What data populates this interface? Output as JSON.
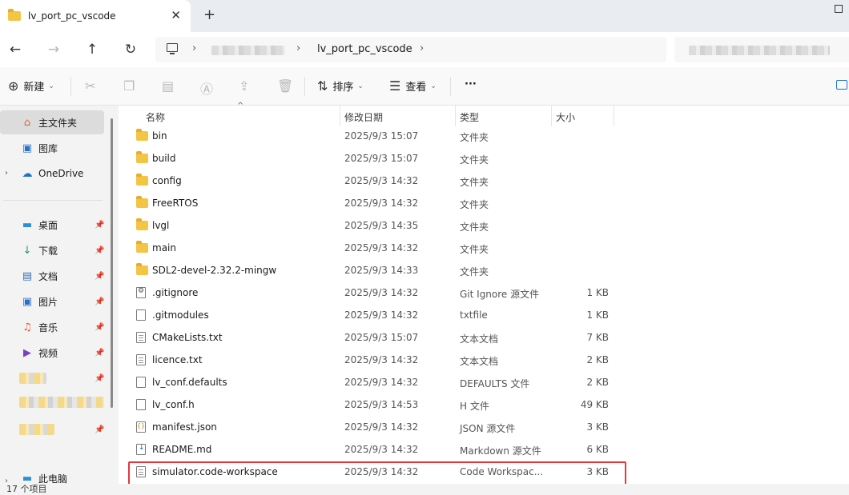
{
  "window": {
    "tab_title": "lv_port_pc_vscode",
    "tab_close": "✕",
    "new_tab": "+"
  },
  "address": {
    "current_folder": "lv_port_pc_vscode",
    "separator": "›"
  },
  "toolbar": {
    "new_label": "新建",
    "sort_label": "排序",
    "view_label": "查看",
    "more_label": "···"
  },
  "sidebar": {
    "home": "主文件夹",
    "gallery": "图库",
    "onedrive": "OneDrive",
    "quick_access": [
      {
        "label": "桌面",
        "icon": "desktop-icon"
      },
      {
        "label": "下载",
        "icon": "download-icon"
      },
      {
        "label": "文档",
        "icon": "documents-icon"
      },
      {
        "label": "图片",
        "icon": "pictures-icon"
      },
      {
        "label": "音乐",
        "icon": "music-icon"
      },
      {
        "label": "视频",
        "icon": "videos-icon"
      }
    ],
    "this_pc": "此电脑"
  },
  "columns": {
    "name": "名称",
    "date": "修改日期",
    "type": "类型",
    "size": "大小"
  },
  "files": [
    {
      "name": "bin",
      "date": "2025/9/3 15:07",
      "type": "文件夹",
      "size": "",
      "kind": "folder"
    },
    {
      "name": "build",
      "date": "2025/9/3 15:07",
      "type": "文件夹",
      "size": "",
      "kind": "folder"
    },
    {
      "name": "config",
      "date": "2025/9/3 14:32",
      "type": "文件夹",
      "size": "",
      "kind": "folder"
    },
    {
      "name": "FreeRTOS",
      "date": "2025/9/3 14:32",
      "type": "文件夹",
      "size": "",
      "kind": "folder"
    },
    {
      "name": "lvgl",
      "date": "2025/9/3 14:35",
      "type": "文件夹",
      "size": "",
      "kind": "folder"
    },
    {
      "name": "main",
      "date": "2025/9/3 14:32",
      "type": "文件夹",
      "size": "",
      "kind": "folder"
    },
    {
      "name": "SDL2-devel-2.32.2-mingw",
      "date": "2025/9/3 14:33",
      "type": "文件夹",
      "size": "",
      "kind": "folder"
    },
    {
      "name": ".gitignore",
      "date": "2025/9/3 14:32",
      "type": "Git Ignore 源文件",
      "size": "1 KB",
      "kind": "gear"
    },
    {
      "name": ".gitmodules",
      "date": "2025/9/3 14:32",
      "type": "txtfile",
      "size": "1 KB",
      "kind": "plain"
    },
    {
      "name": "CMakeLists.txt",
      "date": "2025/9/3 15:07",
      "type": "文本文档",
      "size": "7 KB",
      "kind": "lines"
    },
    {
      "name": "licence.txt",
      "date": "2025/9/3 14:32",
      "type": "文本文档",
      "size": "2 KB",
      "kind": "lines"
    },
    {
      "name": "lv_conf.defaults",
      "date": "2025/9/3 14:32",
      "type": "DEFAULTS 文件",
      "size": "2 KB",
      "kind": "plain"
    },
    {
      "name": "lv_conf.h",
      "date": "2025/9/3 14:53",
      "type": "H 文件",
      "size": "49 KB",
      "kind": "plain"
    },
    {
      "name": "manifest.json",
      "date": "2025/9/3 14:32",
      "type": "JSON 源文件",
      "size": "3 KB",
      "kind": "json"
    },
    {
      "name": "README.md",
      "date": "2025/9/3 14:32",
      "type": "Markdown 源文件",
      "size": "6 KB",
      "kind": "md"
    },
    {
      "name": "simulator.code-workspace",
      "date": "2025/9/3 14:32",
      "type": "Code Workspac...",
      "size": "3 KB",
      "kind": "lines"
    }
  ],
  "status": {
    "item_count": "17 个项目"
  },
  "colors": {
    "highlight_border": "#e5363b",
    "folder": "#f4c445"
  }
}
